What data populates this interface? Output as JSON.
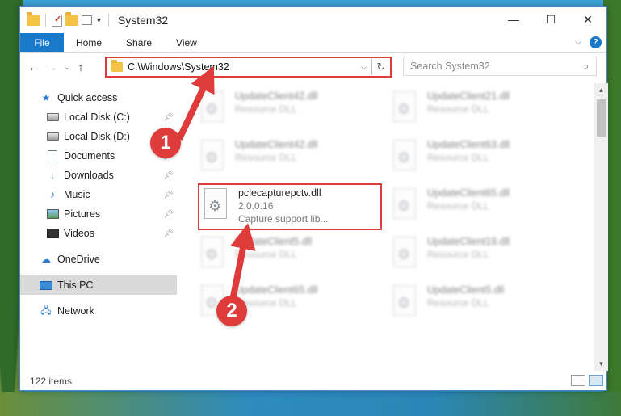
{
  "window": {
    "title": "System32",
    "controls": {
      "minimize": "—",
      "maximize": "☐",
      "close": "✕"
    }
  },
  "ribbon": {
    "tabs": [
      {
        "label": "File"
      },
      {
        "label": "Home"
      },
      {
        "label": "Share"
      },
      {
        "label": "View"
      }
    ],
    "help_label": "?"
  },
  "address": {
    "path": "C:\\Windows\\System32",
    "search_placeholder": "Search System32"
  },
  "nav": {
    "quick_access": "Quick access",
    "items": [
      {
        "label": "Local Disk (C:)",
        "icon": "local-disk-icon"
      },
      {
        "label": "Local Disk (D:)",
        "icon": "local-disk-icon"
      },
      {
        "label": "Documents",
        "icon": "documents-icon"
      },
      {
        "label": "Downloads",
        "icon": "downloads-icon"
      },
      {
        "label": "Music",
        "icon": "music-icon"
      },
      {
        "label": "Pictures",
        "icon": "pictures-icon"
      },
      {
        "label": "Videos",
        "icon": "videos-icon"
      }
    ],
    "onedrive": "OneDrive",
    "this_pc": "This PC",
    "network": "Network"
  },
  "files": {
    "col1": [
      {
        "name": "UpdateClient42.dll",
        "type": "Resource DLL"
      },
      {
        "name": "UpdateClient42.dll",
        "type": "Resource DLL"
      },
      {
        "name": "pclecapturepctv.dll",
        "version": "2.0.0.16",
        "description": "Capture support lib..."
      },
      {
        "name": "UpdateClient5.dll",
        "type": "Resource DLL"
      },
      {
        "name": "UpdateClient65.dll",
        "type": "Resource DLL"
      }
    ],
    "col2": [
      {
        "name": "UpdateClient21.dll",
        "type": "Resource DLL"
      },
      {
        "name": "UpdateClient63.dll",
        "type": "Resource DLL"
      },
      {
        "name": "UpdateClient65.dll",
        "type": "Resource DLL"
      },
      {
        "name": "UpdateClient19.dll",
        "type": "Resource DLL"
      },
      {
        "name": "UpdateClient5.dll",
        "type": "Resource DLL"
      }
    ]
  },
  "status": {
    "item_count": "122 items"
  },
  "annotations": {
    "step1": "1",
    "step2": "2",
    "color": "#e03b3b"
  },
  "colors": {
    "accent": "#1979ca",
    "highlight": "#e03b3b"
  }
}
